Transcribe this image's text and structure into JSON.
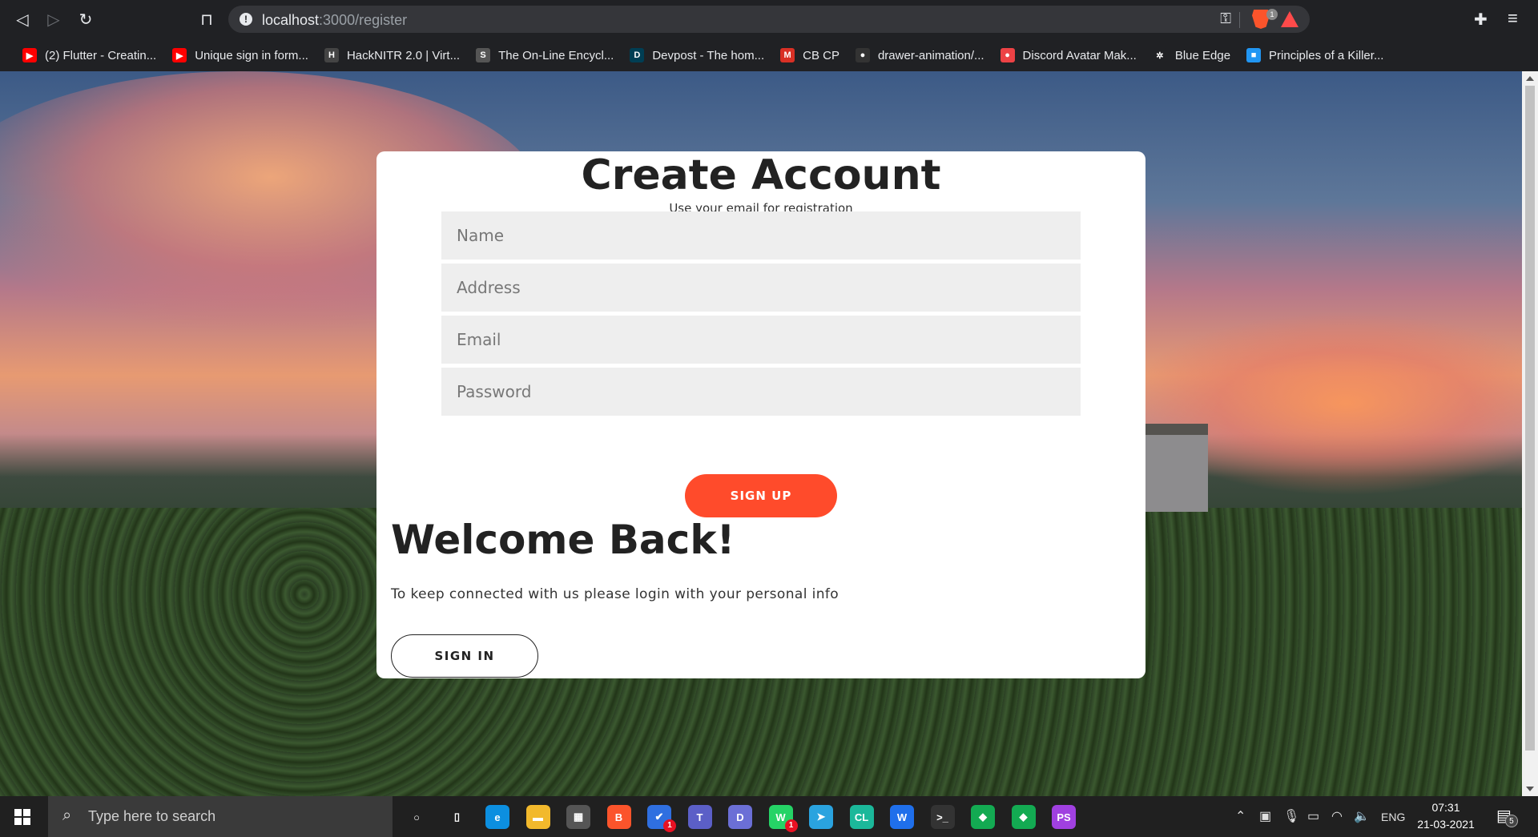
{
  "browser": {
    "url_host": "localhost",
    "url_path": ":3000/register",
    "brave_badge": "1",
    "nav": {
      "back_icon": "back-arrow-icon",
      "forward_icon": "forward-arrow-icon",
      "reload_icon": "reload-icon",
      "bookmark_icon": "bookmark-icon"
    }
  },
  "bookmarks": [
    {
      "label": "(2) Flutter - Creatin...",
      "icon": "youtube-icon",
      "color": "#ff0000",
      "glyph": "▶"
    },
    {
      "label": "Unique sign in form...",
      "icon": "youtube-icon",
      "color": "#ff0000",
      "glyph": "▶"
    },
    {
      "label": "HackNITR 2.0 | Virt...",
      "icon": "hacknitr-icon",
      "color": "#444444",
      "glyph": "H"
    },
    {
      "label": "The On-Line Encycl...",
      "icon": "oeis-icon",
      "color": "#555555",
      "glyph": "S"
    },
    {
      "label": "Devpost - The hom...",
      "icon": "devpost-icon",
      "color": "#003e54",
      "glyph": "D"
    },
    {
      "label": "CB CP",
      "icon": "gmail-icon",
      "color": "#d93025",
      "glyph": "M"
    },
    {
      "label": "drawer-animation/...",
      "icon": "github-icon",
      "color": "#333333",
      "glyph": "●"
    },
    {
      "label": "Discord Avatar Mak...",
      "icon": "discord-icon",
      "color": "#ed4245",
      "glyph": "●"
    },
    {
      "label": "Blue Edge",
      "icon": "react-icon",
      "color": "#202124",
      "glyph": "✲"
    },
    {
      "label": "Principles of a Killer...",
      "icon": "blocks-icon",
      "color": "#2196f3",
      "glyph": "■"
    }
  ],
  "form": {
    "title": "Create Account",
    "subtitle": "Use your email for registration",
    "name_placeholder": "Name",
    "address_placeholder": "Address",
    "email_placeholder": "Email",
    "password_placeholder": "Password",
    "signup_label": "SIGN UP",
    "welcome_title": "Welcome Back!",
    "welcome_text": "To keep connected with us please login with your personal info",
    "signin_label": "SIGN IN"
  },
  "taskbar": {
    "search_placeholder": "Type here to search",
    "apps": [
      {
        "name": "cortana-icon",
        "glyph": "○",
        "bg": "transparent",
        "badge": ""
      },
      {
        "name": "task-view-icon",
        "glyph": "▯",
        "bg": "transparent",
        "badge": ""
      },
      {
        "name": "edge-icon",
        "glyph": "e",
        "bg": "#0c8fe0",
        "badge": ""
      },
      {
        "name": "file-explorer-icon",
        "glyph": "▬",
        "bg": "#f2b92c",
        "badge": ""
      },
      {
        "name": "store-icon",
        "glyph": "▦",
        "bg": "#555555",
        "badge": ""
      },
      {
        "name": "brave-icon",
        "glyph": "B",
        "bg": "#fb542b",
        "badge": ""
      },
      {
        "name": "todo-icon",
        "glyph": "✔",
        "bg": "#2f6fe0",
        "badge": "1"
      },
      {
        "name": "teams-icon",
        "glyph": "T",
        "bg": "#5b5fc7",
        "badge": ""
      },
      {
        "name": "discord-icon",
        "glyph": "D",
        "bg": "#6b6fd6",
        "badge": ""
      },
      {
        "name": "whatsapp-icon",
        "glyph": "W",
        "bg": "#25d366",
        "badge": "1"
      },
      {
        "name": "telegram-icon",
        "glyph": "➤",
        "bg": "#2aa3df",
        "badge": ""
      },
      {
        "name": "clion-icon",
        "glyph": "CL",
        "bg": "#1bb89a",
        "badge": ""
      },
      {
        "name": "webstorm-icon",
        "glyph": "W",
        "bg": "#1f6feb",
        "badge": ""
      },
      {
        "name": "terminal-icon",
        "glyph": ">_",
        "bg": "#333333",
        "badge": ""
      },
      {
        "name": "mongodb-compass-icon",
        "glyph": "◆",
        "bg": "#13aa52",
        "badge": ""
      },
      {
        "name": "mongodb-icon",
        "glyph": "◆",
        "bg": "#13aa52",
        "badge": ""
      },
      {
        "name": "phpstorm-icon",
        "glyph": "PS",
        "bg": "#a040e0",
        "badge": ""
      }
    ],
    "language": "ENG",
    "time": "07:31",
    "date": "21-03-2021",
    "notification_count": "5"
  }
}
